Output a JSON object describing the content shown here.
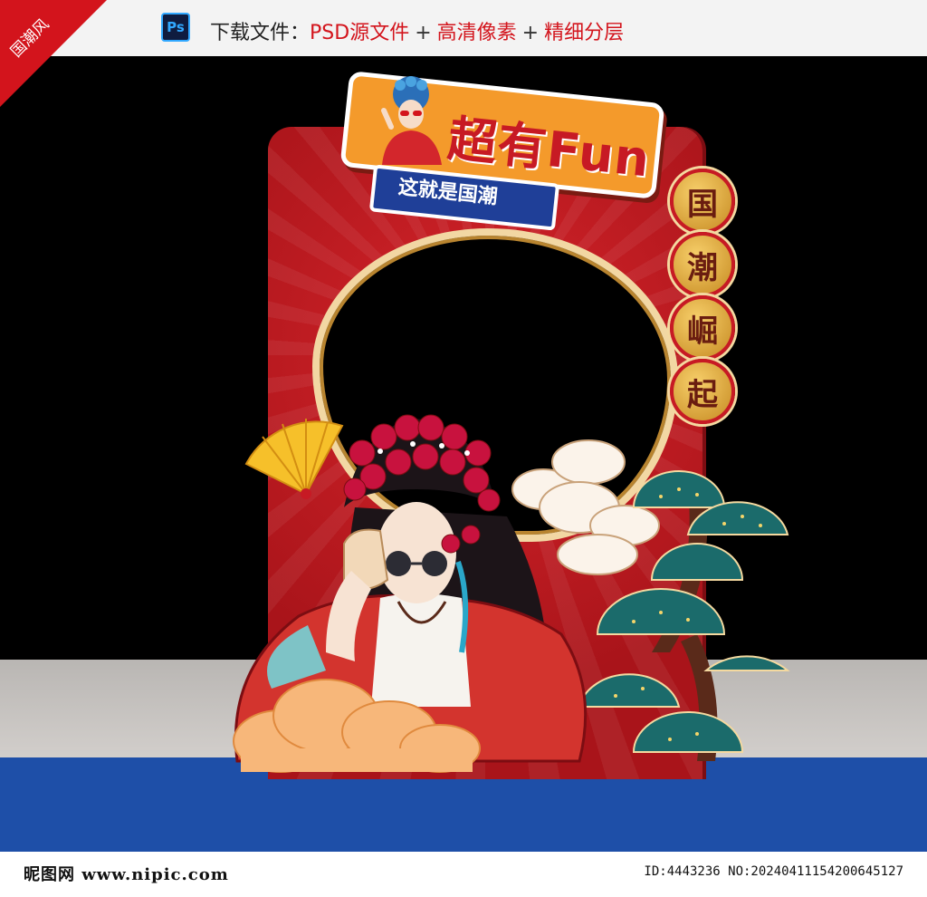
{
  "corner_label": "国潮风",
  "ps_icon_label": "Ps",
  "download": {
    "prefix": "下载文件：",
    "item1": "PSD源文件",
    "item2": "高清像素",
    "item3": "精细分层",
    "plus": "+"
  },
  "sign": {
    "title": "超有Fun",
    "subtitle": "这就是国潮"
  },
  "badges": [
    "国",
    "潮",
    "崛",
    "起"
  ],
  "watermark": {
    "logo": "昵图网 www.nipic.com",
    "id": "ID:4443236 NO:20240411154200645127"
  },
  "colors": {
    "board_red": "#c71a24",
    "sign_orange": "#f49a2b",
    "sign_blue": "#1f3f98",
    "badge_gold": "#e0a43a",
    "stage_blue": "#1e4fa8",
    "accent_red": "#d3141c"
  }
}
